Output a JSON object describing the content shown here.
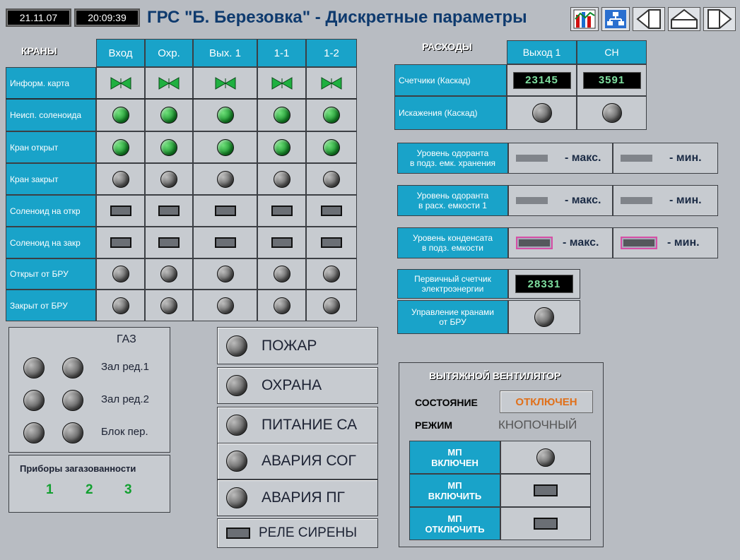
{
  "header": {
    "date": "21.11.07",
    "time": "20:09:39",
    "title": "ГРС \"Б. Березовка\" - Дискретные параметры",
    "nav_icons": [
      "trend-chart-icon",
      "network-scheme-icon",
      "arrow-left-icon",
      "arrow-up-icon",
      "arrow-right-icon"
    ]
  },
  "cranes": {
    "title": "КРАНЫ",
    "columns": [
      "Вход",
      "Охр.",
      "Вых. 1",
      "1-1",
      "1-2"
    ],
    "rows": [
      {
        "label": "Информ. карта",
        "type": "valve",
        "states": [
          "green",
          "green",
          "green",
          "green",
          "green"
        ]
      },
      {
        "label": "Неисп. соленоида",
        "type": "led",
        "states": [
          "green",
          "green",
          "green",
          "green",
          "green"
        ]
      },
      {
        "label": "Кран открыт",
        "type": "led",
        "states": [
          "green",
          "green",
          "green",
          "green",
          "green"
        ]
      },
      {
        "label": "Кран закрыт",
        "type": "led",
        "states": [
          "grey",
          "grey",
          "grey",
          "grey",
          "grey"
        ]
      },
      {
        "label": "Соленоид на откр",
        "type": "rect",
        "states": [
          "grey",
          "grey",
          "grey",
          "grey",
          "grey"
        ]
      },
      {
        "label": "Соленоид на закр",
        "type": "rect",
        "states": [
          "grey",
          "grey",
          "grey",
          "grey",
          "grey"
        ]
      },
      {
        "label": "Открыт от БРУ",
        "type": "led",
        "states": [
          "grey",
          "grey",
          "grey",
          "grey",
          "grey"
        ]
      },
      {
        "label": "Закрыт от БРУ",
        "type": "led",
        "states": [
          "grey",
          "grey",
          "grey",
          "grey",
          "grey"
        ]
      }
    ]
  },
  "flows": {
    "title": "РАСХОДЫ",
    "columns": [
      "Выход 1",
      "СН"
    ],
    "counters_label": "Счетчики (Каскад)",
    "counter_values": [
      "23145",
      "3591"
    ],
    "distortion_label": "Искажения (Каскад)"
  },
  "levels": [
    {
      "label_1": "Уровень одоранта",
      "label_2": "в подз. емк. хранения",
      "max": "- макс.",
      "min": "- мин.",
      "style": "dash"
    },
    {
      "label_1": "Уровень одоранта",
      "label_2": "в расх. емкости 1",
      "max": "- макс.",
      "min": "- мин.",
      "style": "dash"
    },
    {
      "label_1": "Уровень конденсата",
      "label_2": "в подз. емкости",
      "max": "- макс.",
      "min": "- мин.",
      "style": "pink"
    }
  ],
  "energy": {
    "label_1": "Первичный счетчик",
    "label_2": "электроэнергии",
    "value": "28331"
  },
  "bru_control": {
    "label_1": "Управление кранами",
    "label_2": "от БРУ"
  },
  "gas": {
    "title": "ГАЗ",
    "rows": [
      "Зал ред.1",
      "Зал ред.2",
      "Блок пер."
    ],
    "detectors_title": "Приборы загазованности",
    "detectors": [
      "1",
      "2",
      "3"
    ]
  },
  "alarms": [
    "ПОЖАР",
    "ОХРАНА",
    "ПИТАНИЕ СА",
    "АВАРИЯ СОГ",
    "АВАРИЯ ПГ"
  ],
  "siren": "РЕЛЕ СИРЕНЫ",
  "fan": {
    "title": "ВЫТЯЖНОЙ ВЕНТИЛЯТОР",
    "state_label": "СОСТОЯНИЕ",
    "state_value": "ОТКЛЮЧЕН",
    "mode_label": "РЕЖИМ",
    "mode_value": "КНОПОЧНЫЙ",
    "rows": [
      {
        "line_1": "МП",
        "line_2": "ВКЛЮЧЕН",
        "type": "led"
      },
      {
        "line_1": "МП",
        "line_2": "ВКЛЮЧИТЬ",
        "type": "rect"
      },
      {
        "line_1": "МП",
        "line_2": "ОТКЛЮЧИТЬ",
        "type": "rect"
      }
    ]
  },
  "colors": {
    "accent": "#19a3c9",
    "led_on": "#12a030",
    "led_off": "#5a5a5a",
    "title": "#0e3a6e",
    "state_off": "#e0701a",
    "digits": "#7fe0a0"
  }
}
